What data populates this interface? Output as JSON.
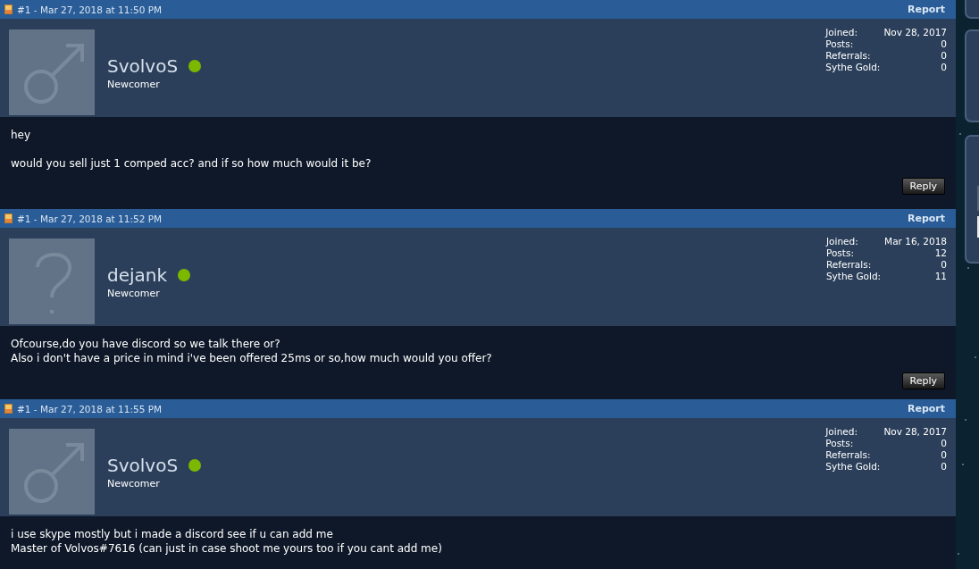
{
  "posts": [
    {
      "number": "#1 - Mar 27, 2018 at 11:50 PM",
      "report": "Report",
      "username": "SvolvoS",
      "online": true,
      "rank": "Newcomer",
      "avatar": {
        "kind": "male"
      },
      "stats": [
        {
          "label": "Joined:",
          "value": "Nov 28, 2017"
        },
        {
          "label": "Posts:",
          "value": "0"
        },
        {
          "label": "Referrals:",
          "value": "0"
        },
        {
          "label": "Sythe Gold:",
          "value": "0"
        }
      ],
      "paragraphs": [
        "hey",
        "would you sell just 1 comped acc? and if so how much would it be?"
      ],
      "reply": "Reply"
    },
    {
      "number": "#1 - Mar 27, 2018 at 11:52 PM",
      "report": "Report",
      "username": "dejank",
      "online": true,
      "rank": "Newcomer",
      "avatar": {
        "kind": "unknown"
      },
      "stats": [
        {
          "label": "Joined:",
          "value": "Mar 16, 2018"
        },
        {
          "label": "Posts:",
          "value": "12"
        },
        {
          "label": "Referrals:",
          "value": "0"
        },
        {
          "label": "Sythe Gold:",
          "value": "11"
        }
      ],
      "paragraphs": [
        "Ofcourse,do you have discord so we talk there or?\nAlso i don't have a price in mind i've been offered 25ms or so,how much would you offer?"
      ],
      "reply": "Reply"
    },
    {
      "number": "#1 - Mar 27, 2018 at 11:55 PM",
      "report": "Report",
      "username": "SvolvoS",
      "online": true,
      "rank": "Newcomer",
      "avatar": {
        "kind": "male"
      },
      "stats": [
        {
          "label": "Joined:",
          "value": "Nov 28, 2017"
        },
        {
          "label": "Posts:",
          "value": "0"
        },
        {
          "label": "Referrals:",
          "value": "0"
        },
        {
          "label": "Sythe Gold:",
          "value": "0"
        }
      ],
      "paragraphs": [
        "i use skype mostly but i made a discord see if u can add me\nMaster of Volvos#7616 (can just in case shoot me yours too if you cant add me)"
      ]
    }
  ]
}
